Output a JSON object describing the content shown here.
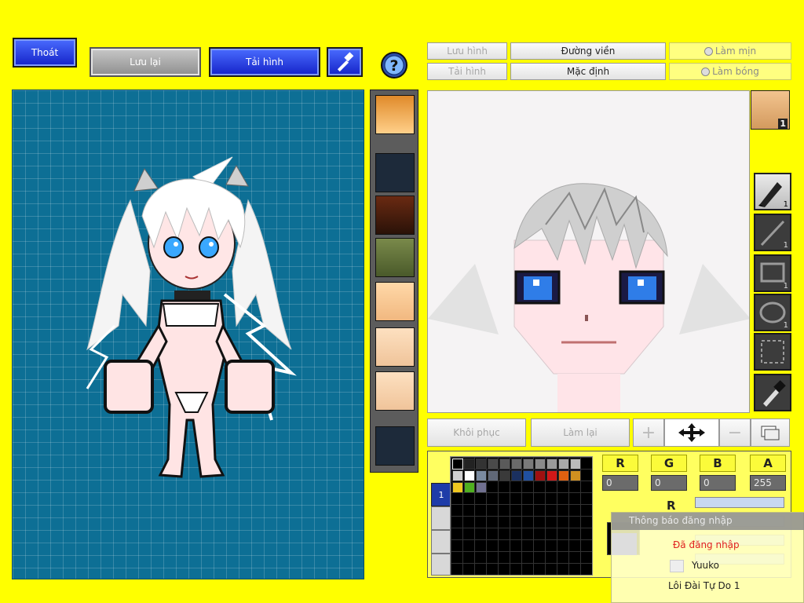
{
  "top_buttons": {
    "exit": "Thoát",
    "save": "Lưu lại",
    "reload": "Tải hình"
  },
  "editor_tabs": {
    "save_image": "Lưu hình",
    "load_image": "Tải hình",
    "outline": "Đường viền",
    "default": "Mặc định",
    "smooth": "Làm mịn",
    "shade": "Làm bóng"
  },
  "bottom_buttons": {
    "restore": "Khôi phục",
    "redo": "Làm lại"
  },
  "tool_counts": {
    "portrait_badge": "1",
    "pen": "1",
    "line": "1",
    "rect": "1",
    "ellipse": "1"
  },
  "rgba": {
    "r_label": "R",
    "g_label": "G",
    "b_label": "B",
    "a_label": "A",
    "r": "0",
    "g": "0",
    "b": "0",
    "a": "255"
  },
  "layer_tab": "1",
  "notification": {
    "title": "Thông báo đăng nhập",
    "status": "Đã đăng nhập",
    "user": "Yuuko",
    "room": "Lôi Đài Tự Do 1"
  },
  "colors": {
    "background": "#ffff00",
    "canvas_grid": "#0d6f95",
    "button_blue": "#1a30d8",
    "status_red": "#e02020"
  },
  "icons": [
    "hammer-icon",
    "help-icon",
    "pen-icon",
    "line-icon",
    "rectangle-icon",
    "ellipse-icon",
    "selection-icon",
    "eyedropper-icon",
    "move-icon",
    "zoom-in-icon",
    "zoom-out-icon",
    "layers-icon"
  ]
}
